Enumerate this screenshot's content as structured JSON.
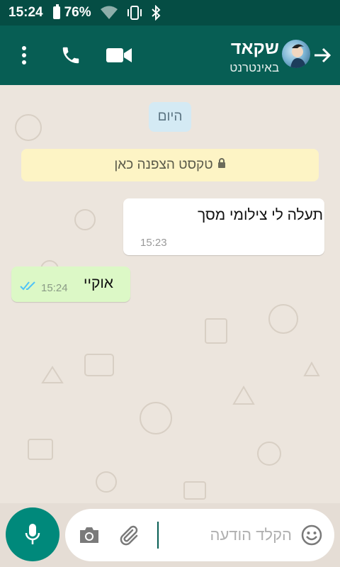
{
  "status_bar": {
    "time": "15:24",
    "battery_percent": "76%",
    "icons": [
      "battery-icon",
      "wifi-icon",
      "vibrate-icon",
      "bluetooth-icon"
    ]
  },
  "header": {
    "contact_name": "שקאד",
    "contact_status": "באינטרנט",
    "icons": [
      "back-arrow-icon",
      "avatar",
      "video-call-icon",
      "phone-icon",
      "more-options-icon"
    ],
    "color": "#075e54"
  },
  "chat": {
    "date_label": "היום",
    "encryption_text": "טקסט הצפנה כאן",
    "messages": [
      {
        "direction": "incoming",
        "text": "תעלה לי צילומי מסך",
        "time": "15:23"
      },
      {
        "direction": "outgoing",
        "text": "אוקיי",
        "time": "15:24",
        "status": "read"
      }
    ]
  },
  "composer": {
    "placeholder": "הקלד הודעה",
    "value": ""
  },
  "colors": {
    "accent": "#00897b",
    "outgoing_bubble": "#dcf8c6",
    "incoming_bubble": "#ffffff",
    "read_ticks": "#4fc3f7"
  }
}
